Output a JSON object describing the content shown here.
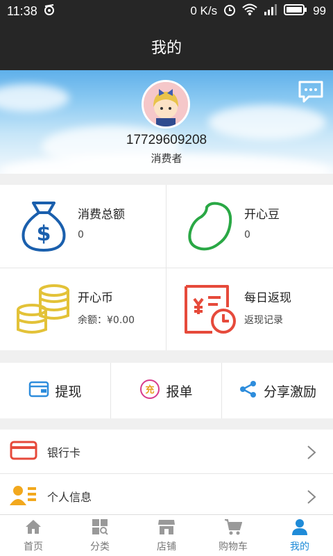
{
  "status_bar": {
    "time": "11:38",
    "network_speed": "0 K/s",
    "battery": "99",
    "signal_label": "4G"
  },
  "page_title": "我的",
  "profile": {
    "phone": "17729609208",
    "role": "消费者"
  },
  "stats": [
    {
      "title": "消费总额",
      "value": "0",
      "icon": "money-bag-icon"
    },
    {
      "title": "开心豆",
      "value": "0",
      "icon": "bean-icon"
    },
    {
      "title": "开心币",
      "value": "余额：¥0.00",
      "icon": "coins-icon"
    },
    {
      "title": "每日返现",
      "value": "返现记录",
      "icon": "cashback-icon"
    }
  ],
  "actions": [
    {
      "label": "提现",
      "icon": "wallet-icon"
    },
    {
      "label": "报单",
      "icon": "recharge-icon"
    },
    {
      "label": "分享激励",
      "icon": "share-icon"
    }
  ],
  "list": [
    {
      "label": "银行卡",
      "icon": "bank-card-icon"
    },
    {
      "label": "个人信息",
      "icon": "personal-info-icon"
    }
  ],
  "bottom_nav": [
    {
      "label": "首页",
      "icon": "home-icon"
    },
    {
      "label": "分类",
      "icon": "category-icon"
    },
    {
      "label": "店铺",
      "icon": "store-icon"
    },
    {
      "label": "购物车",
      "icon": "cart-icon"
    },
    {
      "label": "我的",
      "icon": "user-icon",
      "active": true
    }
  ],
  "colors": {
    "header_bg": "#262626",
    "accent": "#1f8bd8",
    "blue_icon": "#1a5fad",
    "green_icon": "#2aa845",
    "gold_icon": "#e3c238",
    "red_icon": "#e64a3b"
  }
}
